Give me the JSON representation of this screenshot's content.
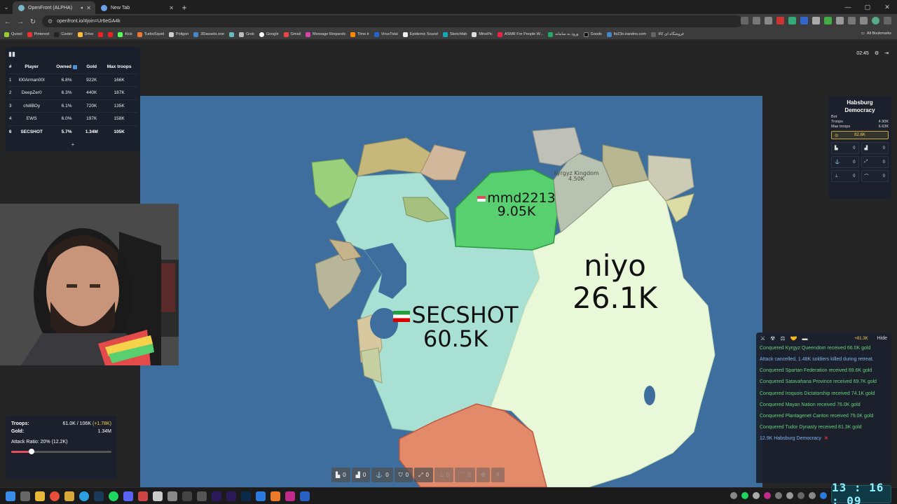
{
  "browser": {
    "tabs": [
      {
        "label": "OpenFront (ALPHA)",
        "active": true
      },
      {
        "label": "New Tab",
        "active": false
      }
    ],
    "url": "openfront.io/#join=Ur6eGA4k",
    "bookmarks": [
      "Quixel",
      "Pinterest",
      "Cooler",
      "Drive",
      "",
      "Kick",
      "TurboSquid",
      "Poligon",
      "3Dassets.one",
      "",
      "Grok",
      "Google",
      "Gmail",
      "Message Requests",
      "Time.lr",
      "VirusTotal",
      "Epidemic Sound",
      "Sketchfab",
      "MinePic",
      "ASMR For People W...",
      "ورود به سامانه",
      "Goods",
      "lts23o.irandns.com",
      "فروشگاه ای کالا"
    ],
    "all_bookmarks": "All Bookmarks"
  },
  "leaderboard": {
    "headers": {
      "rank": "#",
      "player": "Player",
      "owned": "Owned",
      "gold": "Gold",
      "troops": "Max troops"
    },
    "rows": [
      {
        "rank": "1",
        "player": "I00Arman00I",
        "owned": "6.8%",
        "gold": "922K",
        "troops": "166K"
      },
      {
        "rank": "2",
        "player": "DeepZer0",
        "owned": "6.3%",
        "gold": "440K",
        "troops": "187K"
      },
      {
        "rank": "3",
        "player": "chillBOy",
        "owned": "6.1%",
        "gold": "720K",
        "troops": "135K"
      },
      {
        "rank": "4",
        "player": "EWS",
        "owned": "6.0%",
        "gold": "197K",
        "troops": "158K"
      },
      {
        "rank": "6",
        "player": "SECSHOT",
        "owned": "5.7%",
        "gold": "1.34M",
        "troops": "105K"
      }
    ],
    "more": "+"
  },
  "game_timer": "02:45",
  "map_labels": {
    "mmd_name": "mmd2213",
    "mmd_troops": "9.05K",
    "niyo_name": "niyo",
    "niyo_troops": "26.1K",
    "secshot_name": "SECSHOT",
    "secshot_troops": "60.5K",
    "kyrgyz_name": "Kyrgyz Kingdom",
    "kyrgyz_troops": "4.50K"
  },
  "info_panel": {
    "title": "Habsburg Democracy",
    "type": "Bot",
    "troops_label": "Troops",
    "troops_value": "4.90K",
    "max_troops_label": "Max troops",
    "max_troops_value": "6.63K",
    "gold": "82.6K",
    "counts": [
      "0",
      "0",
      "0",
      "0",
      "0",
      "0"
    ]
  },
  "events": {
    "gold_income": "+81.3K",
    "hide_label": "Hide",
    "items": [
      {
        "text": "Conquered Kyrgyz Queendom received 66.0K gold",
        "type": "green"
      },
      {
        "text": "Attack cancelled, 1.48K soldiers killed during retreat.",
        "type": "blue"
      },
      {
        "text": "Conquered Spartan Federation received 69.6K gold",
        "type": "green"
      },
      {
        "text": "Conquered Satavahana Province received 69.7K gold",
        "type": "green"
      },
      {
        "text": "Conquered Iroquois Dictatorship received 74.1K gold",
        "type": "green"
      },
      {
        "text": "Conquered Mayan Nation received 76.0K gold",
        "type": "green"
      },
      {
        "text": "Conquered Plantagenet Canton received 79.0K gold",
        "type": "green"
      },
      {
        "text": "Conquered Tudor Dynasty received 81.3K gold",
        "type": "green"
      },
      {
        "text": "12.9K Habsburg Democracy",
        "type": "blue"
      }
    ]
  },
  "control_panel": {
    "troops_label": "Troops:",
    "troops_value": "61.0K / 106K",
    "troops_rate": "(+1.78K)",
    "gold_label": "Gold:",
    "gold_value": "1.34M",
    "attack_ratio": "Attack Ratio: 20% (12.2K)",
    "attack_ratio_percent": 20
  },
  "build_bar": {
    "counts": [
      "0",
      "0",
      "0",
      "0",
      "0",
      "0",
      "0"
    ],
    "hotkeys": [
      "1",
      "2",
      "3",
      "4",
      "5",
      "6",
      "7"
    ]
  },
  "clock": "13 : 16 : 09",
  "colors": {
    "ocean": "#3e6e9d",
    "secshot": "#a8e0d4",
    "niyo": "#e8f8d8",
    "mmd": "#58d070",
    "gold": "#f5d24a",
    "event_green": "#67d37a",
    "event_blue": "#7fb6f0"
  }
}
